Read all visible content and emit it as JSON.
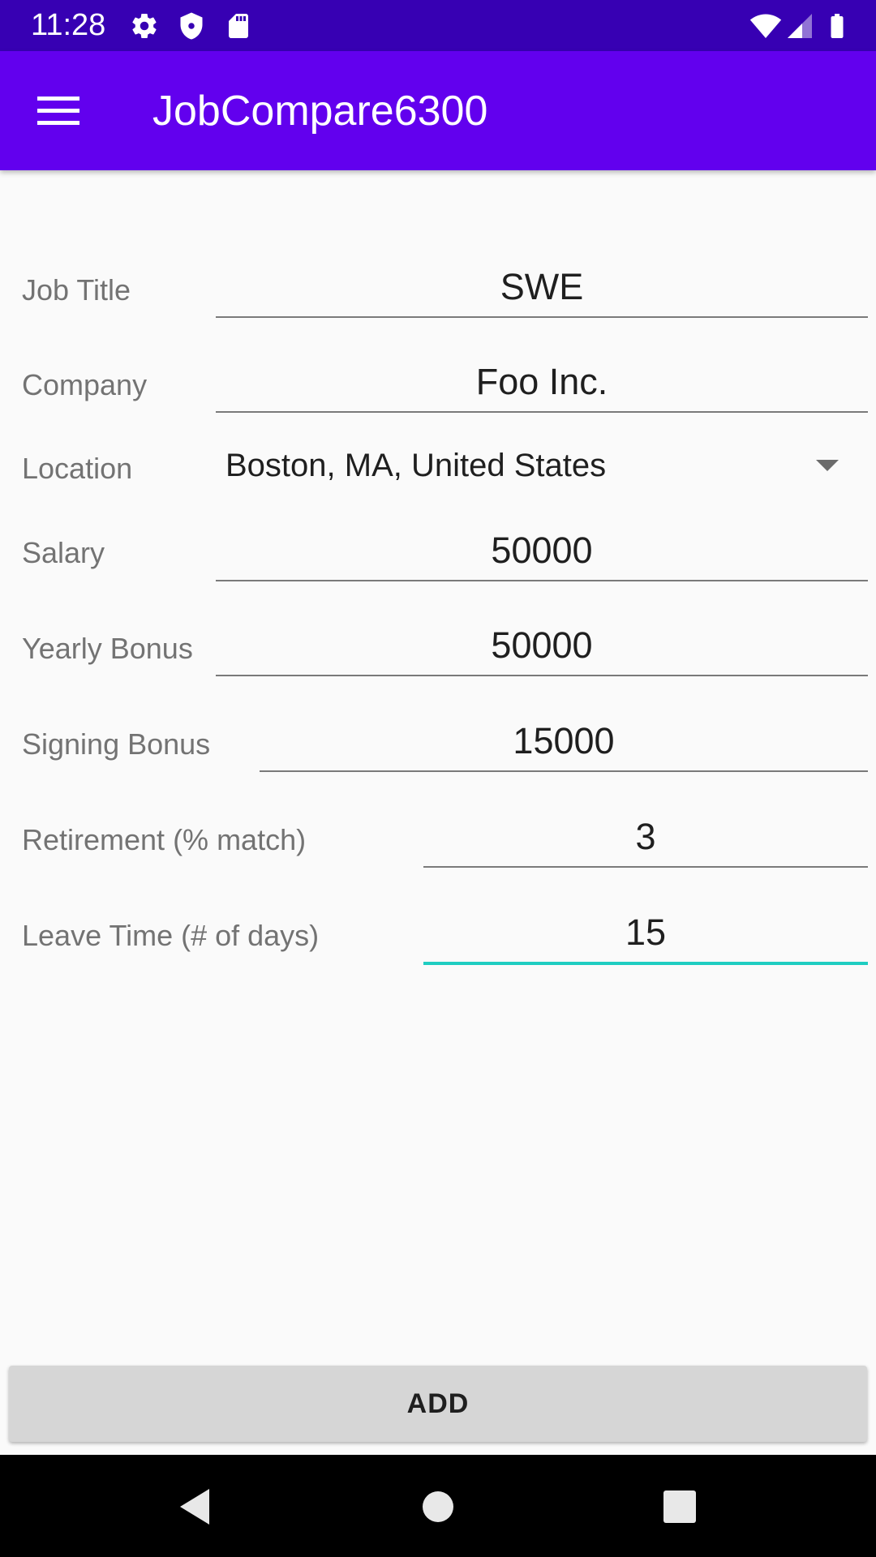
{
  "status_bar": {
    "time": "11:28",
    "icons_left": [
      "gear-icon",
      "shield-icon",
      "sd-card-icon"
    ],
    "icons_right": [
      "wifi-icon",
      "cellular-signal-icon",
      "battery-icon"
    ]
  },
  "app_bar": {
    "title": "JobCompare6300",
    "menu_icon": "hamburger-menu-icon"
  },
  "form": {
    "job_title": {
      "label": "Job Title",
      "value": "SWE"
    },
    "company": {
      "label": "Company",
      "value": "Foo Inc."
    },
    "location": {
      "label": "Location",
      "value": "Boston, MA, United States"
    },
    "salary": {
      "label": "Salary",
      "value": "50000"
    },
    "yearly_bonus": {
      "label": "Yearly Bonus",
      "value": "50000"
    },
    "signing_bonus": {
      "label": "Signing Bonus",
      "value": "15000"
    },
    "retirement": {
      "label": "Retirement (% match)",
      "value": "3"
    },
    "leave_time": {
      "label": "Leave Time (# of days)",
      "value": "15"
    }
  },
  "add_button": {
    "label": "ADD"
  },
  "nav_bar": {
    "icons": [
      "back-icon",
      "home-icon",
      "recents-icon"
    ]
  },
  "colors": {
    "status_bar": "#3700b3",
    "app_bar": "#6200ee",
    "focus_underline": "#1fcdc1",
    "background": "#fafafa",
    "button": "#d6d6d6"
  }
}
